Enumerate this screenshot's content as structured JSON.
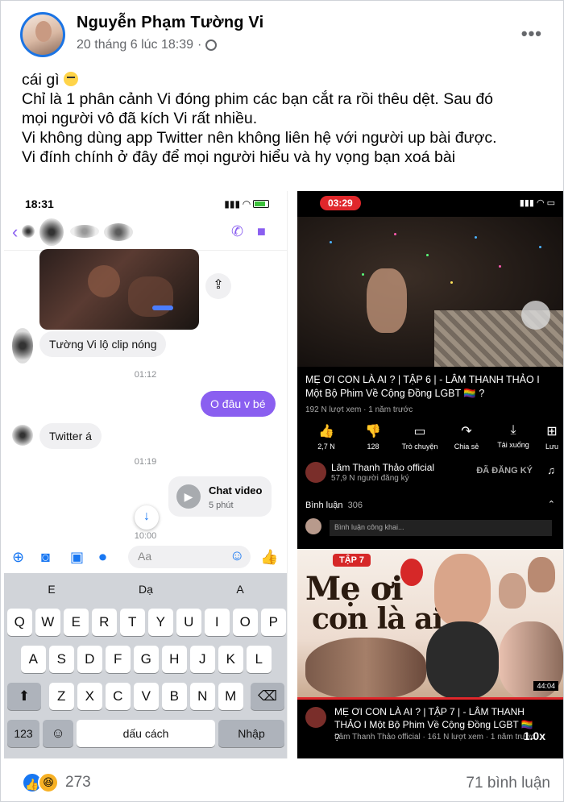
{
  "post": {
    "author": "Nguyễn Phạm Tường Vi",
    "timestamp": "20 tháng 6 lúc 18:39",
    "more_icon": "more-dots-icon",
    "caption_lines": [
      "cái gì",
      "Chỉ là 1 phân cảnh Vi đóng phim các bạn cắt ra rồi thêu dệt. Sau đó",
      "mọi người vô đã kích Vi rất nhiều.",
      "Vi không dùng app Twitter nên không liên hệ với người up bài được.",
      "Vi đính chính ở đây để mọi người hiểu và hy vọng bạn xoá bài"
    ],
    "reaction_count": "273",
    "comment_count": "71 bình luận"
  },
  "messenger": {
    "status_time": "18:31",
    "messages": {
      "in_1": "Tường Vi lộ clip nóng",
      "time_1": "01:12",
      "out_1": "O đâu v bé",
      "in_2": "Twitter á",
      "time_2": "01:19",
      "call_title": "Chat video",
      "call_sub": "5 phút",
      "time_3": "10:00"
    },
    "composer_placeholder": "Aa",
    "suggestions": [
      "E",
      "Dạ",
      "A"
    ],
    "keys_row1": [
      "Q",
      "W",
      "E",
      "R",
      "T",
      "Y",
      "U",
      "I",
      "O",
      "P"
    ],
    "keys_row2": [
      "A",
      "S",
      "D",
      "F",
      "G",
      "H",
      "J",
      "K",
      "L"
    ],
    "keys_row3": [
      "Z",
      "X",
      "C",
      "V",
      "B",
      "N",
      "M"
    ],
    "key_123": "123",
    "key_space": "dấu cách",
    "key_enter": "Nhập"
  },
  "youtube": {
    "recording_time": "03:29",
    "video_title": "MẸ ƠI CON LÀ AI ? | TẬP 6 | - LÂM THANH THẢO I Một Bộ Phim Về Cộng Đồng LGBT 🏳️‍🌈 ?",
    "video_meta": "192 N lượt xem · 1 năm trước",
    "actions": [
      {
        "icon": "thumbs-up-icon",
        "label": "2,7 N"
      },
      {
        "icon": "thumbs-down-icon",
        "label": "128"
      },
      {
        "icon": "comment-icon",
        "label": "Trò chuyện"
      },
      {
        "icon": "share-icon",
        "label": "Chia sẻ"
      },
      {
        "icon": "download-icon",
        "label": "Tải xuống"
      },
      {
        "icon": "save-icon",
        "label": "Lưu"
      }
    ],
    "channel": "Lâm Thanh Thảo official",
    "subscribers": "57,9 N người đăng ký",
    "subscribed": "ĐÃ ĐĂNG KÝ",
    "comments_label": "Bình luận",
    "comments_count": "306",
    "comment_placeholder": "Bình luận công khai...",
    "thumb_badge": "TẬP 7",
    "thumb_title_1": "Mẹ ơi",
    "thumb_title_2": "con là ai",
    "thumb_duration": "44:04",
    "next_title": "MẸ ƠI CON LÀ AI ? | TẬP 7 | - LÂM THANH THẢO I Một Bộ Phim Về Cộng Đồng LGBT 🏳️‍🌈 ?",
    "next_meta": "Lâm Thanh Thảo official · 161 N lượt xem · 1 năm trước",
    "speed": "1.0x"
  }
}
